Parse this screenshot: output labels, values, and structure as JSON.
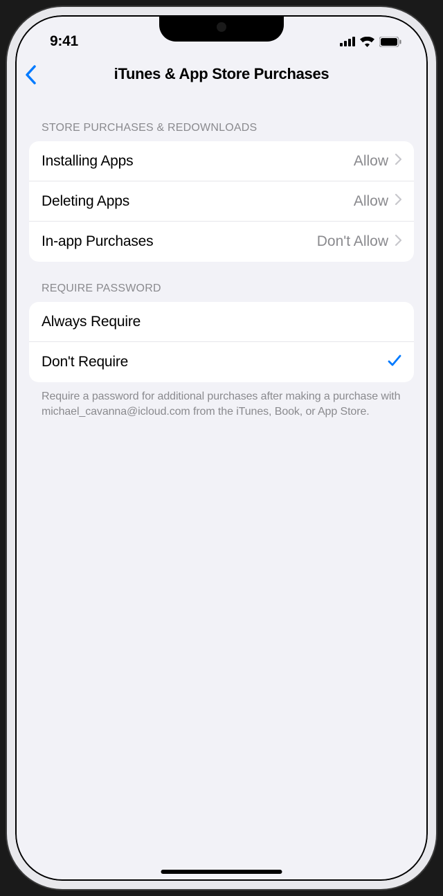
{
  "status_bar": {
    "time": "9:41"
  },
  "nav": {
    "title": "iTunes & App Store Purchases"
  },
  "sections": {
    "store_purchases": {
      "header": "STORE PURCHASES & REDOWNLOADS",
      "rows": [
        {
          "label": "Installing Apps",
          "value": "Allow"
        },
        {
          "label": "Deleting Apps",
          "value": "Allow"
        },
        {
          "label": "In-app Purchases",
          "value": "Don't Allow"
        }
      ]
    },
    "require_password": {
      "header": "REQUIRE PASSWORD",
      "rows": [
        {
          "label": "Always Require",
          "checked": false
        },
        {
          "label": "Don't Require",
          "checked": true
        }
      ],
      "footer": "Require a password for additional purchases after making a purchase with michael_cavanna@icloud.com from the iTunes, Book, or App Store."
    }
  }
}
